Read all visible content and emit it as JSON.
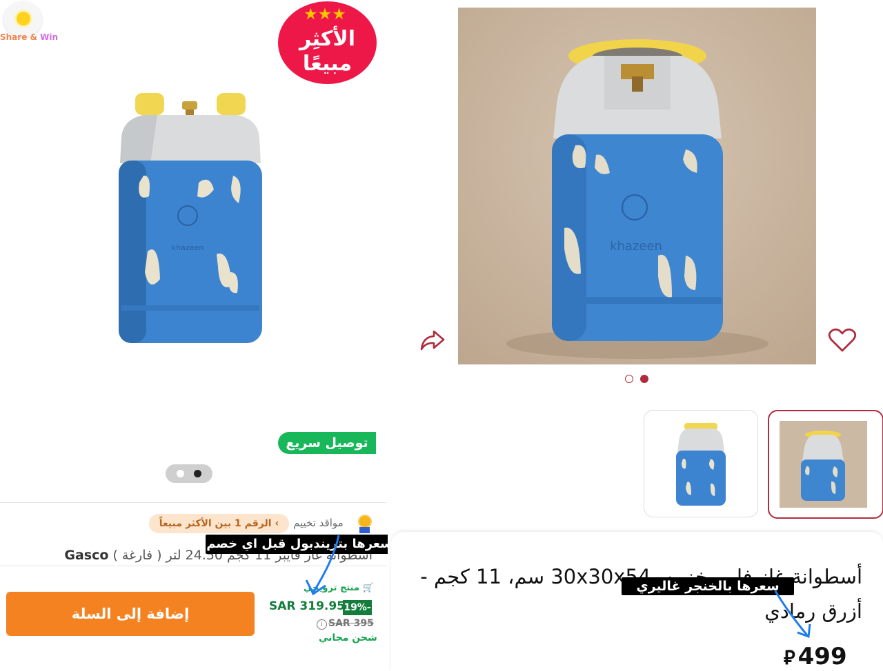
{
  "share_win": {
    "part1": "Share & ",
    "part2": "Win"
  },
  "left": {
    "best_seller_badge": {
      "stars": "★★★",
      "line1": "الأكثِر",
      "line2": "مبيعًا"
    },
    "fast_delivery": "توصيل سريع",
    "seller": "مواقد تخييم",
    "rank_badge": "الرقم 1 بين الأكثر مبيعاً",
    "annotation": "سعرها بتريندبول قبل اي خصم",
    "title": "أسطوانة غاز فايبر 11 كجم 24.50 لتر ( فارغة )",
    "brand": "Gasco",
    "add_to_cart": "إضافة إلى السلة",
    "trending": "منتج ترويجي",
    "sale_price": "SAR 319.95",
    "discount": "19%-",
    "old_price": "SAR 395",
    "free_shipping": "شحن مجاني",
    "gallery_index": 2,
    "gallery_count": 2
  },
  "right": {
    "title": "أسطوانة غاز فايبر خزين، 30x30x54 سم، 11 كجم - أزرق رمادي",
    "annotation": "سعرها بالخنجر غاليري",
    "price": "499",
    "currency_icon": "riyal-symbol",
    "gallery_index": 2,
    "gallery_count": 2
  },
  "colors": {
    "brand_red": "#b02c3d",
    "accent_orange": "#f58220",
    "green": "#17b75a",
    "cylinder_blue": "#3f86d0",
    "cylinder_grey": "#d8dadc",
    "cylinder_yellow": "#f1d44a"
  }
}
